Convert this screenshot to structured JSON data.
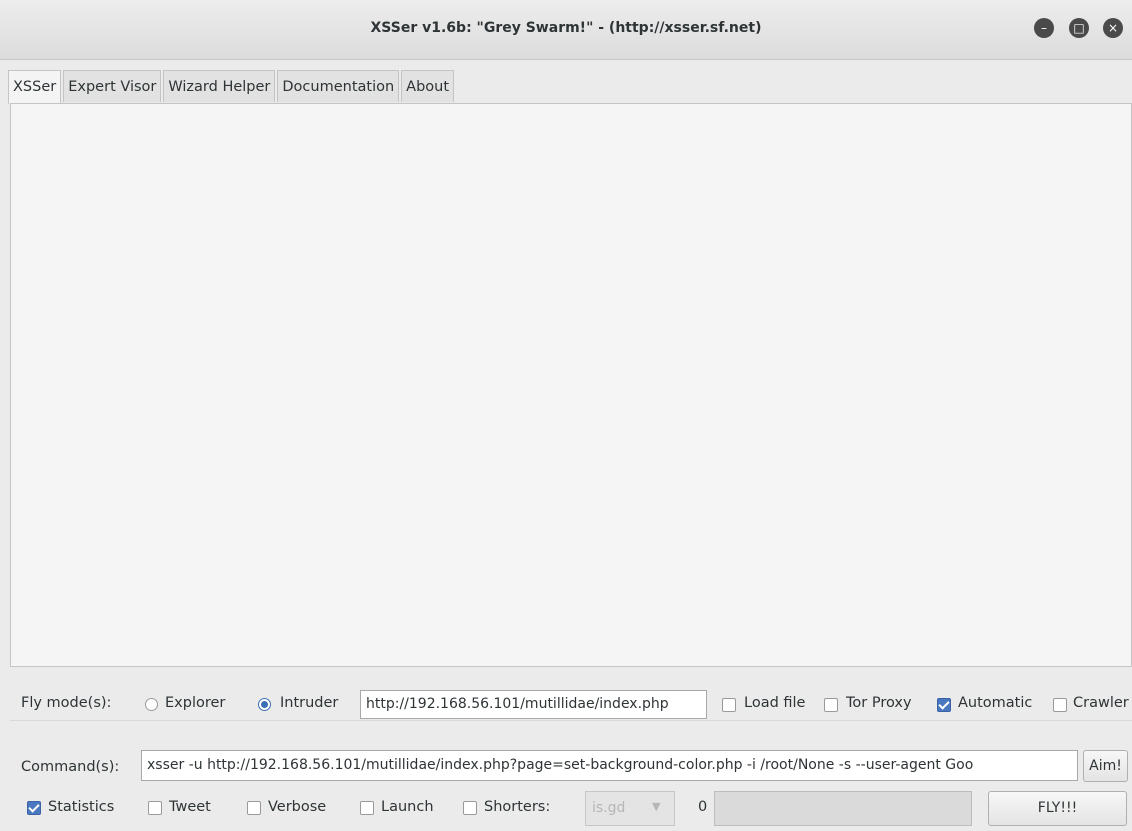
{
  "window": {
    "title": "XSSer v1.6b: \"Grey Swarm!\" - (http://xsser.sf.net)",
    "controls": {
      "minimize": "–",
      "maximize": "□",
      "close": "×"
    }
  },
  "tabs": [
    {
      "label": "XSSer",
      "active": true
    },
    {
      "label": "Expert Visor"
    },
    {
      "label": "Wizard Helper"
    },
    {
      "label": "Documentation"
    },
    {
      "label": "About"
    }
  ],
  "fly": {
    "label": "Fly mode(s):",
    "explorer_label": "Explorer",
    "intruder_label": "Intruder",
    "selected": "Intruder",
    "url": "http://192.168.56.101/mutillidae/index.php",
    "load_file_label": "Load file",
    "tor_proxy_label": "Tor Proxy",
    "automatic_label": "Automatic",
    "crawler_label": "Crawler",
    "load_file": false,
    "tor_proxy": false,
    "automatic": true,
    "crawler": false
  },
  "command": {
    "label": "Command(s):",
    "value": "xsser -u http://192.168.56.101/mutillidae/index.php?page=set-background-color.php -i /root/None -s --user-agent Goo",
    "aim_label": "Aim!"
  },
  "options": {
    "statistics_label": "Statistics",
    "tweet_label": "Tweet",
    "verbose_label": "Verbose",
    "launch_label": "Launch",
    "shorters_label": "Shorters:",
    "statistics": true,
    "tweet": false,
    "verbose": false,
    "launch": false,
    "shorters": false,
    "shortener_value": "is.gd",
    "counter": "0",
    "fly_label": "FLY!!!"
  },
  "colors": {
    "accent": "#4a78c0",
    "window_bg": "#ebebeb"
  }
}
